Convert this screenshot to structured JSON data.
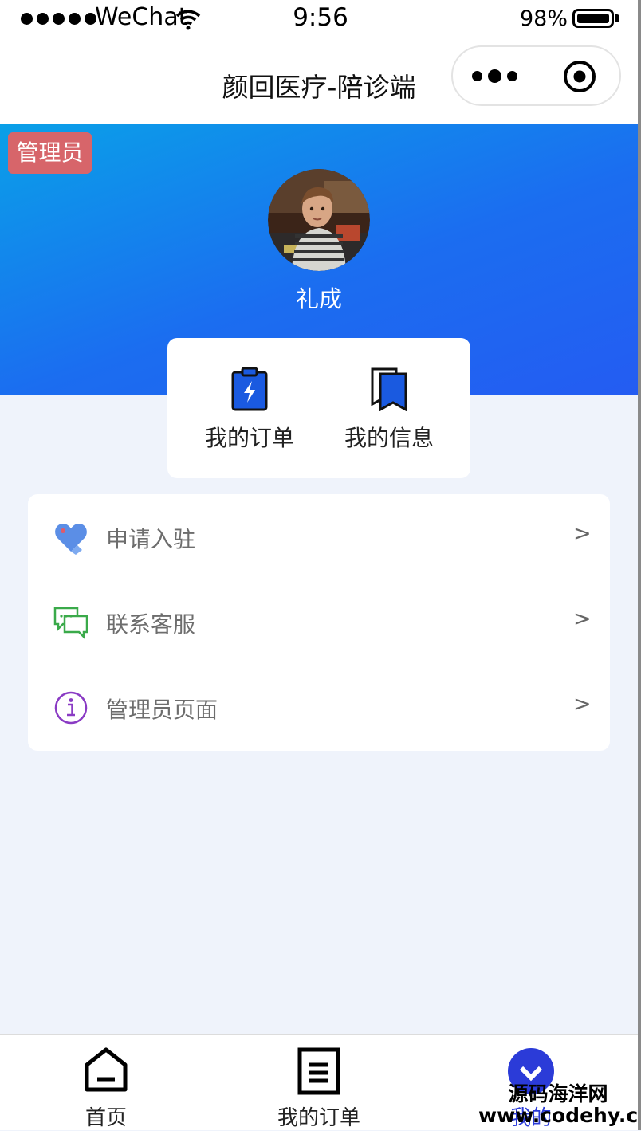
{
  "status_bar": {
    "carrier": "WeChat",
    "time": "9:56",
    "battery": "98%"
  },
  "nav": {
    "title": "颜回医疗-陪诊端",
    "more_icon": "more-dots-icon",
    "close_icon": "target-close-icon"
  },
  "profile": {
    "badge": "管理员",
    "name": "礼成"
  },
  "quick_actions": [
    {
      "label": "我的订单",
      "icon": "clipboard-bolt-icon"
    },
    {
      "label": "我的信息",
      "icon": "bookmark-stack-icon"
    }
  ],
  "menu": [
    {
      "label": "申请入驻",
      "icon": "heart-tag-icon",
      "arrow": ">"
    },
    {
      "label": "联系客服",
      "icon": "chat-bubbles-icon",
      "arrow": ">"
    },
    {
      "label": "管理员页面",
      "icon": "info-circle-icon",
      "arrow": ">"
    }
  ],
  "tabs": [
    {
      "label": "首页",
      "icon": "home-icon"
    },
    {
      "label": "我的订单",
      "icon": "document-icon"
    },
    {
      "label": "我的",
      "icon": "user-icon",
      "active": true
    }
  ],
  "watermark": {
    "line1": "源码海洋网",
    "line2": "www.codehy.com"
  },
  "colors": {
    "accent": "#245cf2",
    "badge": "#d7656a",
    "background": "#eff3fb"
  }
}
